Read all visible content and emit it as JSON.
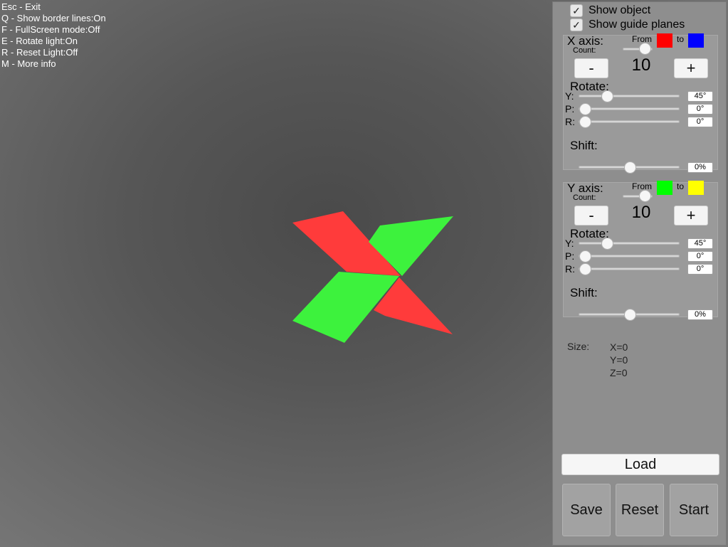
{
  "help": {
    "lines": [
      "Esc - Exit",
      "Q - Show border lines:On",
      "F - FullScreen mode:Off",
      "E - Rotate light:On",
      "R - Reset Light:Off",
      "M - More info"
    ]
  },
  "scene": {
    "colors": {
      "red": "#ff3b3b",
      "green": "#3df23d"
    }
  },
  "panel": {
    "show_object": {
      "label": "Show object",
      "checked": true
    },
    "show_guide_planes": {
      "label": "Show guide planes",
      "checked": true
    },
    "x_axis": {
      "title": "X axis:",
      "count_label": "Count:",
      "from_label": "From",
      "to_label": "to",
      "from_color": "#ff0000",
      "to_color": "#0000ff",
      "count_value": "10",
      "minus_label": "-",
      "plus_label": "+",
      "rotate_label": "Rotate:",
      "rotations": [
        {
          "key": "Y:",
          "value": "45°",
          "level": 0.25
        },
        {
          "key": "P:",
          "value": "0°",
          "level": 0.0
        },
        {
          "key": "R:",
          "value": "0°",
          "level": 0.0
        }
      ],
      "shift_label": "Shift:",
      "shift_value": "0%",
      "shift_level": 0.5,
      "count_level": 0.9
    },
    "y_axis": {
      "title": "Y axis:",
      "count_label": "Count:",
      "from_label": "From",
      "to_label": "to",
      "from_color": "#00ff00",
      "to_color": "#ffff00",
      "count_value": "10",
      "minus_label": "-",
      "plus_label": "+",
      "rotate_label": "Rotate:",
      "rotations": [
        {
          "key": "Y:",
          "value": "45°",
          "level": 0.25
        },
        {
          "key": "P:",
          "value": "0°",
          "level": 0.0
        },
        {
          "key": "R:",
          "value": "0°",
          "level": 0.0
        }
      ],
      "shift_label": "Shift:",
      "shift_value": "0%",
      "shift_level": 0.5,
      "count_level": 0.9
    },
    "size": {
      "label": "Size:",
      "x": "X=0",
      "y": "Y=0",
      "z": "Z=0"
    },
    "buttons": {
      "load": "Load",
      "save": "Save",
      "reset": "Reset",
      "start": "Start"
    }
  }
}
